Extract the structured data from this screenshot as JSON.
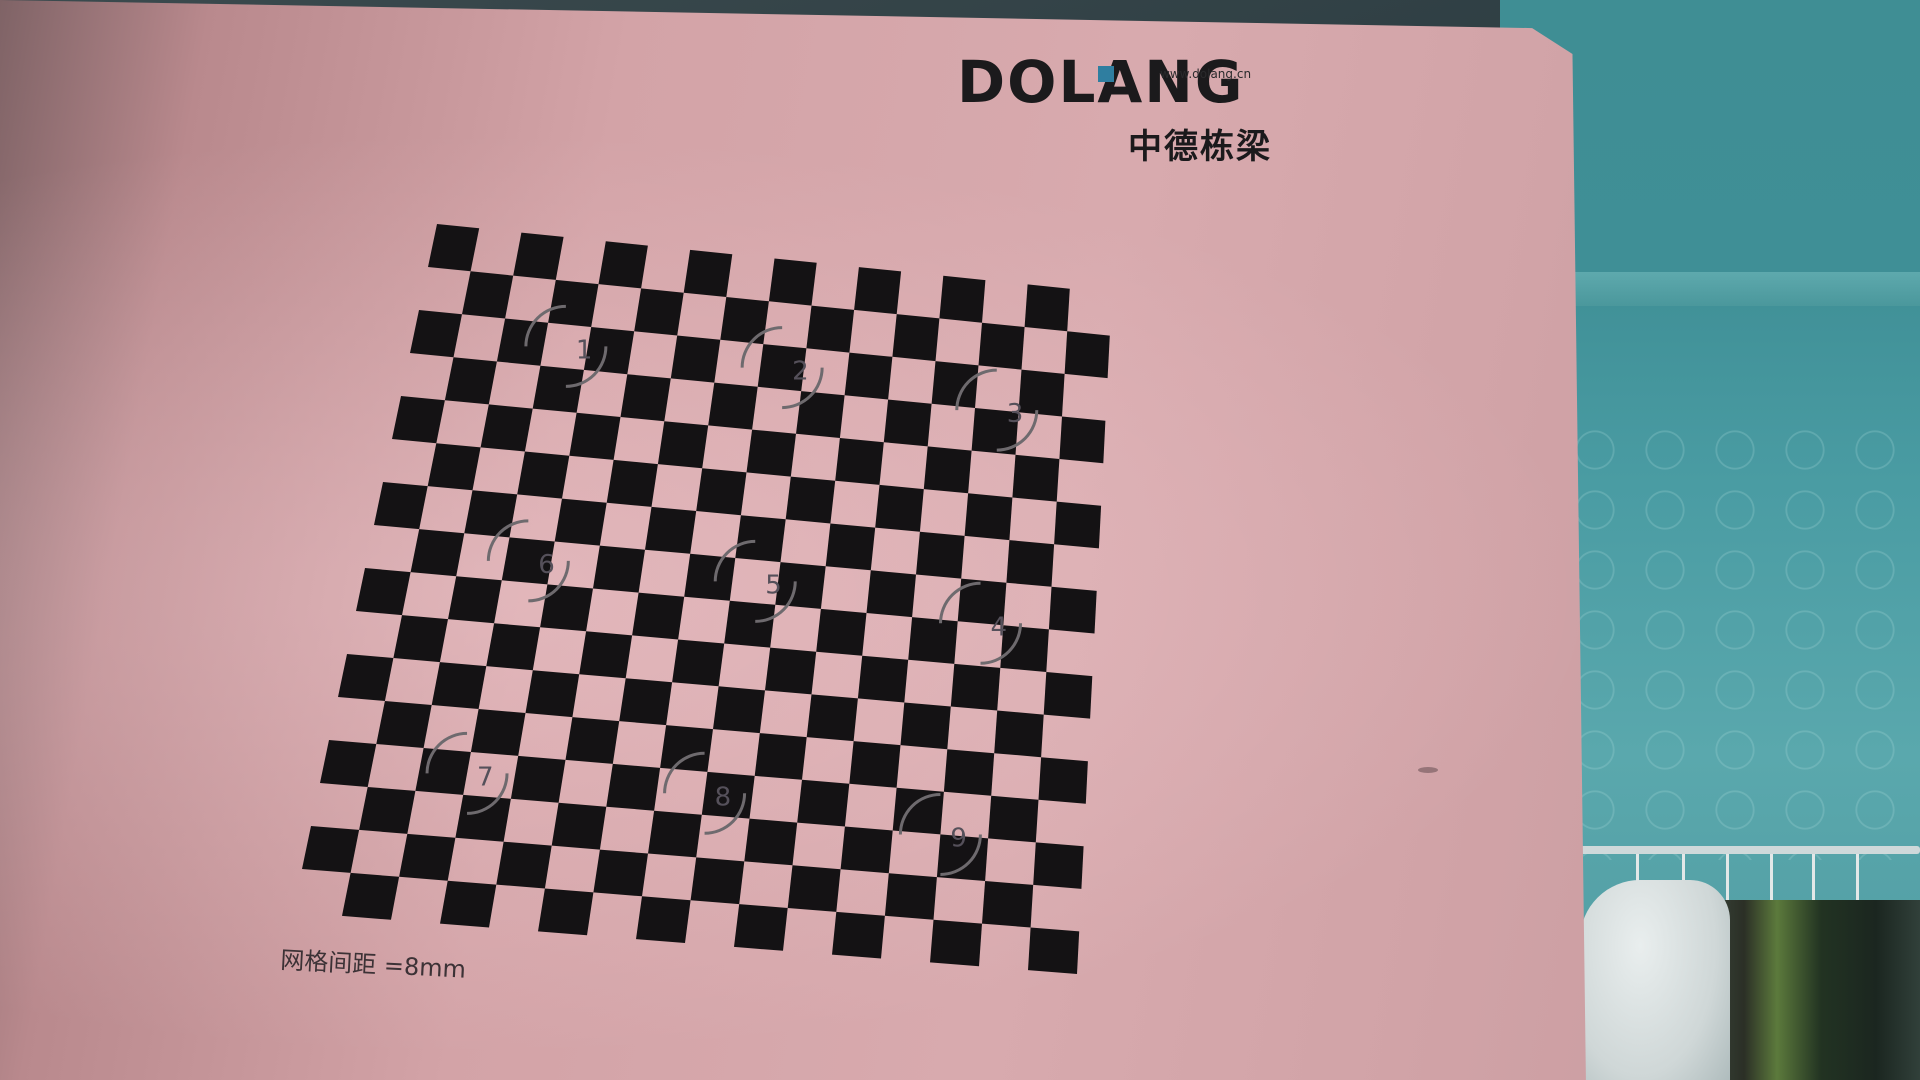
{
  "brand": {
    "logo_text": "DOLANG",
    "website": "www.dolang.cn",
    "chinese_name": "中德栋梁"
  },
  "checkerboard": {
    "rows": 16,
    "cols": 16,
    "markers": [
      "1",
      "2",
      "3",
      "4",
      "5",
      "6",
      "7",
      "8",
      "9"
    ]
  },
  "caption": "网格间距 =8mm",
  "colors": {
    "board_surface": "#d8aaae",
    "square": "#141214",
    "marker_ring": "#6e6a6e",
    "wall": "#4a9ca3"
  }
}
